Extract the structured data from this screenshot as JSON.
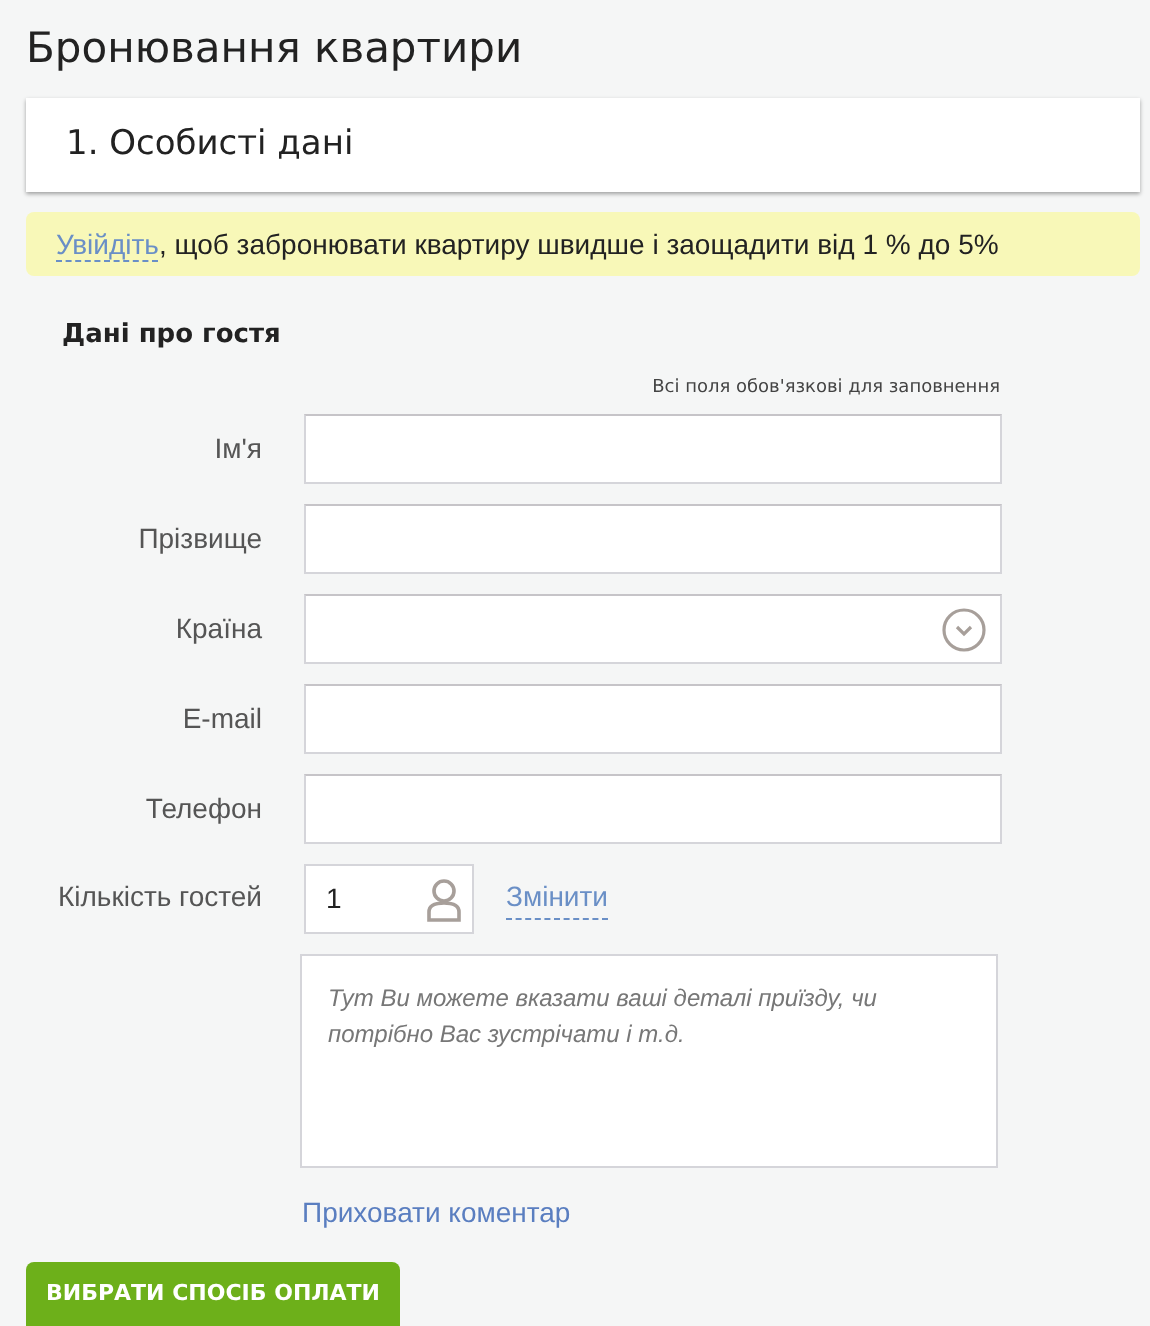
{
  "title": "Бронювання квартири",
  "section": {
    "title": "1. Особисті дані"
  },
  "notice": {
    "link": "Увійдіть",
    "text": ", щоб забронювати квартиру швидше і заощадити від 1 % до 5%"
  },
  "form": {
    "heading": "Дані про гостя",
    "required_note": "Всі поля обов'язкові для заповнення",
    "fields": [
      {
        "label": "Ім'я",
        "kind": "text"
      },
      {
        "label": "Прізвище",
        "kind": "text"
      },
      {
        "label": "Країна",
        "kind": "select"
      },
      {
        "label": "E-mail",
        "kind": "text"
      },
      {
        "label": "Телефон",
        "kind": "text"
      }
    ],
    "guests": {
      "label": "Кількість гостей",
      "value": "1",
      "link": "Змінити"
    },
    "comment": {
      "placeholder": "Тут Ви можете вказати ваші деталі приїзду, чи потрібно Вас зустрічати і т.д."
    },
    "hide_comment": "Приховати коментар"
  },
  "submit": "ВИБРАТИ СПОСІБ ОПЛАТИ"
}
